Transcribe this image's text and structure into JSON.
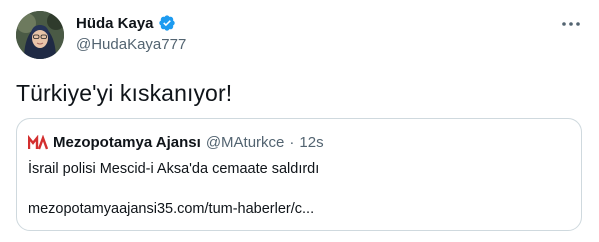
{
  "author": {
    "display_name": "Hüda Kaya",
    "handle": "@HudaKaya777",
    "verified": true
  },
  "tweet": {
    "text": "Türkiye'yi kıskanıyor!"
  },
  "quoted_tweet": {
    "source_name": "Mezopotamya Ajansı",
    "handle": "@MAturkce",
    "separator": "·",
    "time": "12s",
    "text": "İsrail polisi Mescid-i Aksa'da cemaate saldırdı",
    "link": "mezopotamyaajansi35.com/tum-haberler/c..."
  },
  "icons": {
    "more": "more-horizontal-icon",
    "verified": "verified-badge-icon",
    "logo": "ma-logo-icon"
  },
  "colors": {
    "verified_blue": "#1d9bf0",
    "secondary_text": "#536471",
    "border": "#cfd9de",
    "logo_red": "#d32f2f"
  }
}
